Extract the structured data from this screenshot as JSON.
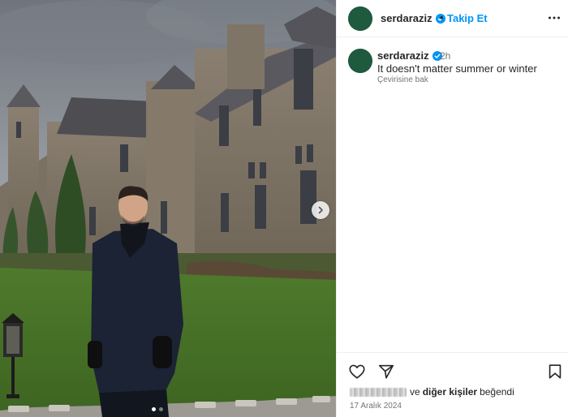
{
  "post": {
    "username": "serdaraziz",
    "follow_separator": "•",
    "follow_label": "Takip Et",
    "caption_username": "serdaraziz",
    "time_ago": "2h",
    "caption_text": "It doesn't matter summer or winter",
    "translate_label": "Çevirisine bak",
    "likes_suffix_bold": "diğer kişiler",
    "likes_connector": "ve",
    "likes_tail": "beğendi",
    "date": "17 Aralık 2024"
  },
  "colors": {
    "follow_blue": "#0095f6",
    "verified_blue": "#0095f6",
    "avatar_green": "#1f5a3e"
  },
  "icons": {
    "more": "more-horizontal-icon",
    "verified": "verified-badge-icon",
    "like": "heart-icon",
    "share": "send-icon",
    "save": "bookmark-icon",
    "carousel_next": "chevron-right-icon"
  },
  "carousel": {
    "slides": 2,
    "active": 1
  }
}
